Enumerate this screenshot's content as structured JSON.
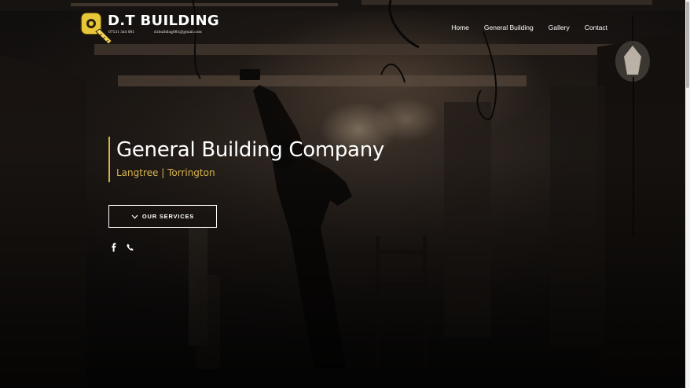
{
  "brand": {
    "name": "D.T BUILDING",
    "phone": "07531 344 081",
    "email": "d.tbuilding081@gmail.com",
    "logo_icon": "tape-measure-icon",
    "accent_color": "#d4b24a"
  },
  "nav": {
    "items": [
      "Home",
      "General Building",
      "Gallery",
      "Contact"
    ]
  },
  "hero": {
    "title": "General Building Company",
    "subtitle": "Langtree | Torrington",
    "button_label": "OUR SERVICES",
    "button_icon": "chevron-down-icon",
    "title_color": "#ffffff",
    "subtitle_color": "#d9b64e"
  },
  "social": {
    "icons": [
      "facebook-icon",
      "phone-icon"
    ]
  }
}
